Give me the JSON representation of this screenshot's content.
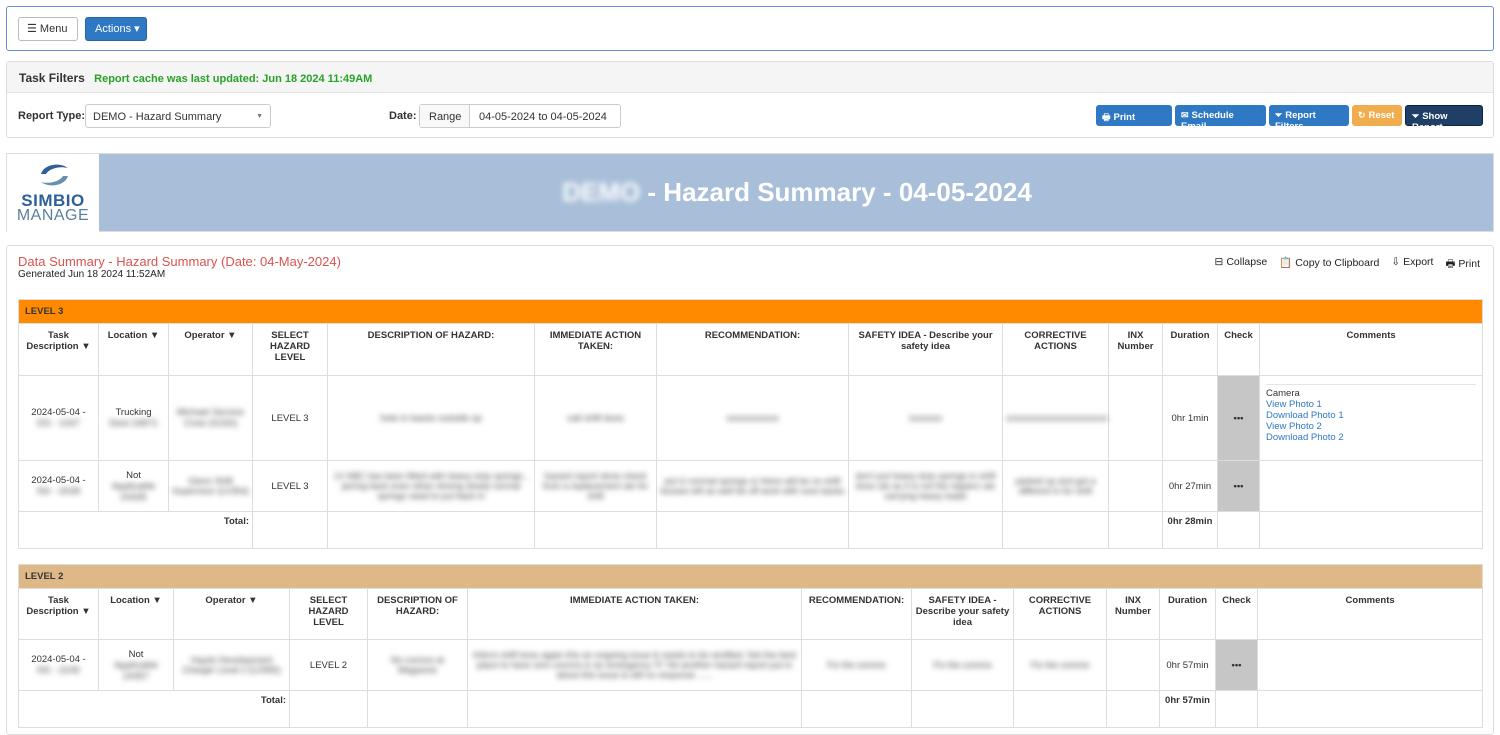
{
  "topbar": {
    "menu_label": "☰ Menu",
    "actions_label": "Actions ▾"
  },
  "filters": {
    "title": "Task Filters",
    "cache_text": "Report cache was last updated: Jun 18 2024 11:49AM",
    "report_type_label": "Report Type:",
    "report_type_value": "DEMO - Hazard Summary",
    "date_label": "Date:",
    "range_addon": "Range",
    "range_value": "04-05-2024 to 04-05-2024",
    "buttons": {
      "print": "Print Report",
      "schedule": "Schedule Email",
      "filters": "Report Filters",
      "reset": "Reset",
      "show": "Show Report"
    },
    "colors": {
      "blue": "#2f78c4",
      "orange": "#f0ad4e",
      "dark": "#1f3f66"
    }
  },
  "banner": {
    "logo_line1": "SIMBIO",
    "logo_line2": "MANAGE",
    "title_prefix": "DEMO",
    "title_main": " - Hazard Summary - 04-05-2024"
  },
  "panel": {
    "title": "Data Summary - Hazard Summary (Date: 04-May-2024)",
    "generated": "Generated Jun 18 2024 11:52AM",
    "tools": [
      "Collapse",
      "Copy to Clipboard",
      "Export",
      "Print"
    ]
  },
  "level3": {
    "label": "LEVEL 3",
    "color": "#ff8a00",
    "headers": [
      "Task Description ▼",
      "Location ▼",
      "Operator ▼",
      "SELECT HAZARD LEVEL",
      "DESCRIPTION OF HAZARD:",
      "IMMEDIATE ACTION TAKEN:",
      "RECOMMENDATION:",
      "SAFETY IDEA - Describe your safety idea",
      "CORRECTIVE ACTIONS",
      "INX Number",
      "Duration",
      "Check",
      "Comments"
    ],
    "rows": [
      {
        "task_a": "2024-05-04 -",
        "task_b": "DS - 1347",
        "loc_a": "Trucking",
        "loc_b": "Dest 24871",
        "operator": "Michael Service Crew (S150)",
        "level": "LEVEL 3",
        "desc": "hole in backs outside sp",
        "action": "call shift boss",
        "rec": "xxxxxxxxxxx",
        "idea": "xxxxxxx",
        "corr": "xxxxxxxxxxxxxxxxxxxxxxx",
        "inx": "",
        "duration": "0hr 1min",
        "check": "•••",
        "comments": {
          "label": "Camera",
          "links": [
            "View Photo 1",
            "Download Photo 1",
            "View Photo 2",
            "Download Photo 2"
          ]
        }
      },
      {
        "task_a": "2024-05-04 -",
        "task_b": "NS - 2028",
        "loc_a": "Not",
        "loc_b": "Applicable 24335",
        "operator": "Glenn Shift Supervisor (LV354)",
        "level": "LEVEL 3",
        "desc": "LV ABC has been fitted with heavy duty springs , jarring back even when driving slowly normal springs need to put back in",
        "action": "hazard report done check from a replacement ute for shift",
        "rec": "put in normal springs or there will be no shift bosses left as well be off work with sore backs",
        "idea": "don't put heavy duty springs in shift boss ute as it is not the nippers ute carrying heavy loads",
        "corr": "parked up and got a different lv for shift",
        "inx": "",
        "duration": "0hr 27min",
        "check": "•••"
      }
    ],
    "total_label": "Total:",
    "total_duration": "0hr 28min"
  },
  "level2": {
    "label": "LEVEL 2",
    "color": "#dfb888",
    "headers": [
      "Task Description ▼",
      "Location ▼",
      "Operator ▼",
      "SELECT HAZARD LEVEL",
      "DESCRIPTION OF HAZARD:",
      "IMMEDIATE ACTION TAKEN:",
      "RECOMMENDATION:",
      "SAFETY IDEA - Describe your safety idea",
      "CORRECTIVE ACTIONS",
      "INX Number",
      "Duration",
      "Check",
      "Comments"
    ],
    "rows": [
      {
        "task_a": "2024-05-04 -",
        "task_b": "NS - 2245",
        "loc_a": "Not",
        "loc_b": "Applicable 24357",
        "operator": "Haydn Development Charger Level 2 (LV583)",
        "level": "LEVEL 2",
        "desc": "No comms at Magazine",
        "action": "Inform shift boss again this an ongoing issue & needs to be rectified. Not the best place to have zero comms in an emergency !!!! Yet another hazard report put in about this issue & still no response ......",
        "rec": "Fix the comms",
        "idea": "Fix the comms",
        "corr": "Fix the comms",
        "inx": "",
        "duration": "0hr 57min",
        "check": "•••"
      }
    ],
    "total_label": "Total:",
    "total_duration": "0hr 57min"
  }
}
